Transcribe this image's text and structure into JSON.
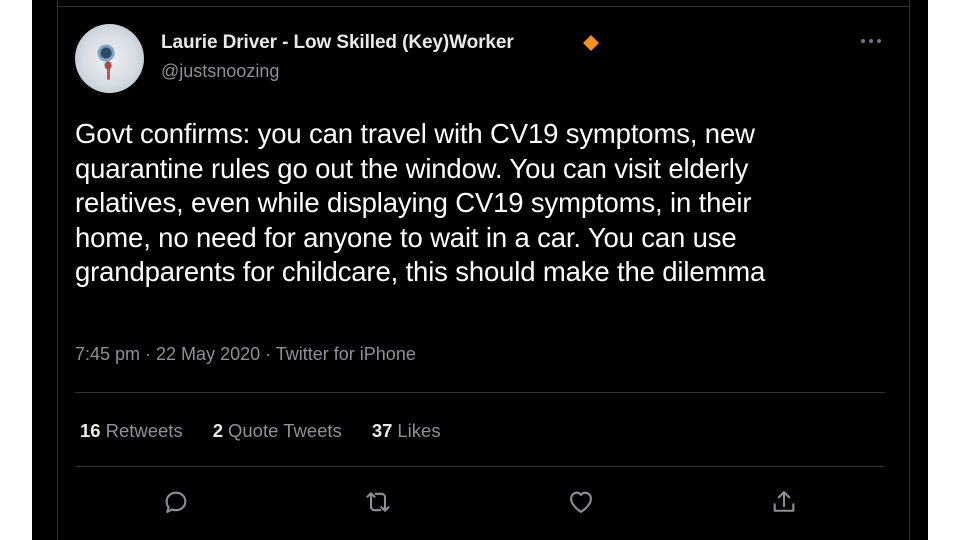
{
  "tweet": {
    "author": {
      "display_name": "Laurie Driver - Low Skilled (Key)Worker",
      "handle": "@justsnoozing",
      "badge_icon": "orange-diamond-icon",
      "badge_color": "#f5921e"
    },
    "text_lines": [
      "Govt confirms: you can travel with CV19 symptoms, new",
      "quarantine rules go out the window. You can visit elderly",
      "relatives, even while displaying CV19 symptoms, in their",
      "home, no need for anyone to wait in a car. You can use",
      "grandparents for childcare, this should make the dilemma"
    ],
    "timestamp": "7:45 pm · 22 May 2020",
    "separator": " · ",
    "source": "Twitter for iPhone",
    "stats": {
      "retweets_count": "16",
      "retweets_label": "Retweets",
      "quotes_count": "2",
      "quotes_label": "Quote Tweets",
      "likes_count": "37",
      "likes_label": "Likes"
    },
    "actions": [
      "reply-icon",
      "retweet-icon",
      "like-icon",
      "share-icon"
    ]
  },
  "theme": {
    "background": "#000000",
    "text_primary": "#e7e9ea",
    "text_secondary": "#8b9197",
    "border": "#2f3336"
  }
}
